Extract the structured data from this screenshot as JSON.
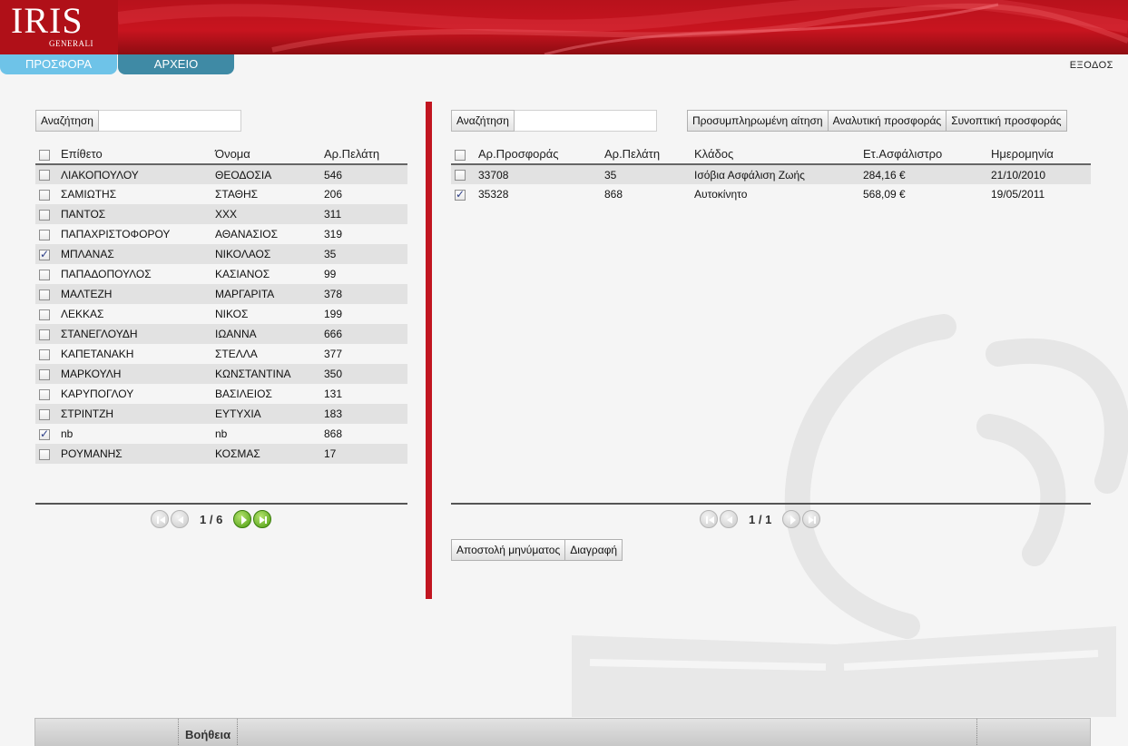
{
  "header": {
    "logo_main": "IRIS",
    "logo_sub": "GENERALI",
    "exit_label": "ΕΞΟΔΟΣ"
  },
  "tabs": [
    {
      "label": "ΠΡΟΣΦΟΡΑ"
    },
    {
      "label": "ΑΡΧΕΙΟ"
    }
  ],
  "left_panel": {
    "search_label": "Αναζήτηση",
    "search_value": "",
    "columns": [
      "Επίθετο",
      "Όνομα",
      "Αρ.Πελάτη"
    ],
    "rows": [
      {
        "surname": "ΛΙΑΚΟΠΟΥΛΟΥ",
        "name": "ΘΕΟΔΟΣΙΑ",
        "client": "546",
        "checked": false
      },
      {
        "surname": "ΣΑΜΙΩΤΗΣ",
        "name": "ΣΤΑΘΗΣ",
        "client": "206",
        "checked": false
      },
      {
        "surname": "ΠΑΝΤΟΣ",
        "name": "XXX",
        "client": "311",
        "checked": false
      },
      {
        "surname": "ΠΑΠΑΧΡΙΣΤΟΦΟΡΟΥ",
        "name": "ΑΘΑΝΑΣΙΟΣ",
        "client": "319",
        "checked": false
      },
      {
        "surname": "ΜΠΛΑΝΑΣ",
        "name": "ΝΙΚΟΛΑΟΣ",
        "client": "35",
        "checked": true
      },
      {
        "surname": "ΠΑΠΑΔΟΠΟΥΛΟΣ",
        "name": "ΚΑΣΙΑΝΟΣ",
        "client": "99",
        "checked": false
      },
      {
        "surname": "ΜΑΛΤΕΖΗ",
        "name": "ΜΑΡΓΑΡΙΤΑ",
        "client": "378",
        "checked": false
      },
      {
        "surname": "ΛΕΚΚΑΣ",
        "name": "ΝΙΚΟΣ",
        "client": "199",
        "checked": false
      },
      {
        "surname": "ΣΤΑΝΕΓΛΟΥΔΗ",
        "name": "ΙΩΑΝΝΑ",
        "client": "666",
        "checked": false
      },
      {
        "surname": "ΚΑΠΕΤΑΝΑΚΗ",
        "name": "ΣΤΕΛΛΑ",
        "client": "377",
        "checked": false
      },
      {
        "surname": "ΜΑΡΚΟΥΛΗ",
        "name": "ΚΩΝΣΤΑΝΤΙΝΑ",
        "client": "350",
        "checked": false
      },
      {
        "surname": "ΚΑΡΥΠΟΓΛΟΥ",
        "name": "ΒΑΣΙΛΕΙΟΣ",
        "client": "131",
        "checked": false
      },
      {
        "surname": "ΣΤΡΙΝΤΖΗ",
        "name": "ΕΥΤΥΧΙΑ",
        "client": "183",
        "checked": false
      },
      {
        "surname": "nb",
        "name": "nb",
        "client": "868",
        "checked": true
      },
      {
        "surname": "ΡΟΥΜΑΝΗΣ",
        "name": "ΚΟΣΜΑΣ",
        "client": "17",
        "checked": false
      }
    ],
    "pager_text": "1 / 6"
  },
  "right_panel": {
    "search_label": "Αναζήτηση",
    "search_value": "",
    "action_buttons": [
      "Προσυμπληρωμένη αίτηση",
      "Αναλυτική προσφοράς",
      "Συνοπτική προσφοράς"
    ],
    "columns": [
      "Αρ.Προσφοράς",
      "Αρ.Πελάτη",
      "Κλάδος",
      "Ετ.Ασφάλιστρο",
      "Ημερομηνία"
    ],
    "rows": [
      {
        "offer": "33708",
        "client": "35",
        "branch": "Ισόβια Ασφάλιση Ζωής",
        "premium": "284,16 €",
        "date": "21/10/2010",
        "checked": false
      },
      {
        "offer": "35328",
        "client": "868",
        "branch": "Αυτοκίνητο",
        "premium": "568,09 €",
        "date": "19/05/2011",
        "checked": true
      }
    ],
    "pager_text": "1 / 1",
    "bottom_buttons": [
      "Αποστολή μηνύματος",
      "Διαγραφή"
    ]
  },
  "footer": {
    "help_label": "Βοήθεια"
  },
  "colors": {
    "brand_red": "#c11520",
    "tab_active": "#6ec3e8",
    "tab_inactive": "#3f8aa5",
    "pager_active": "#4a9b10"
  }
}
